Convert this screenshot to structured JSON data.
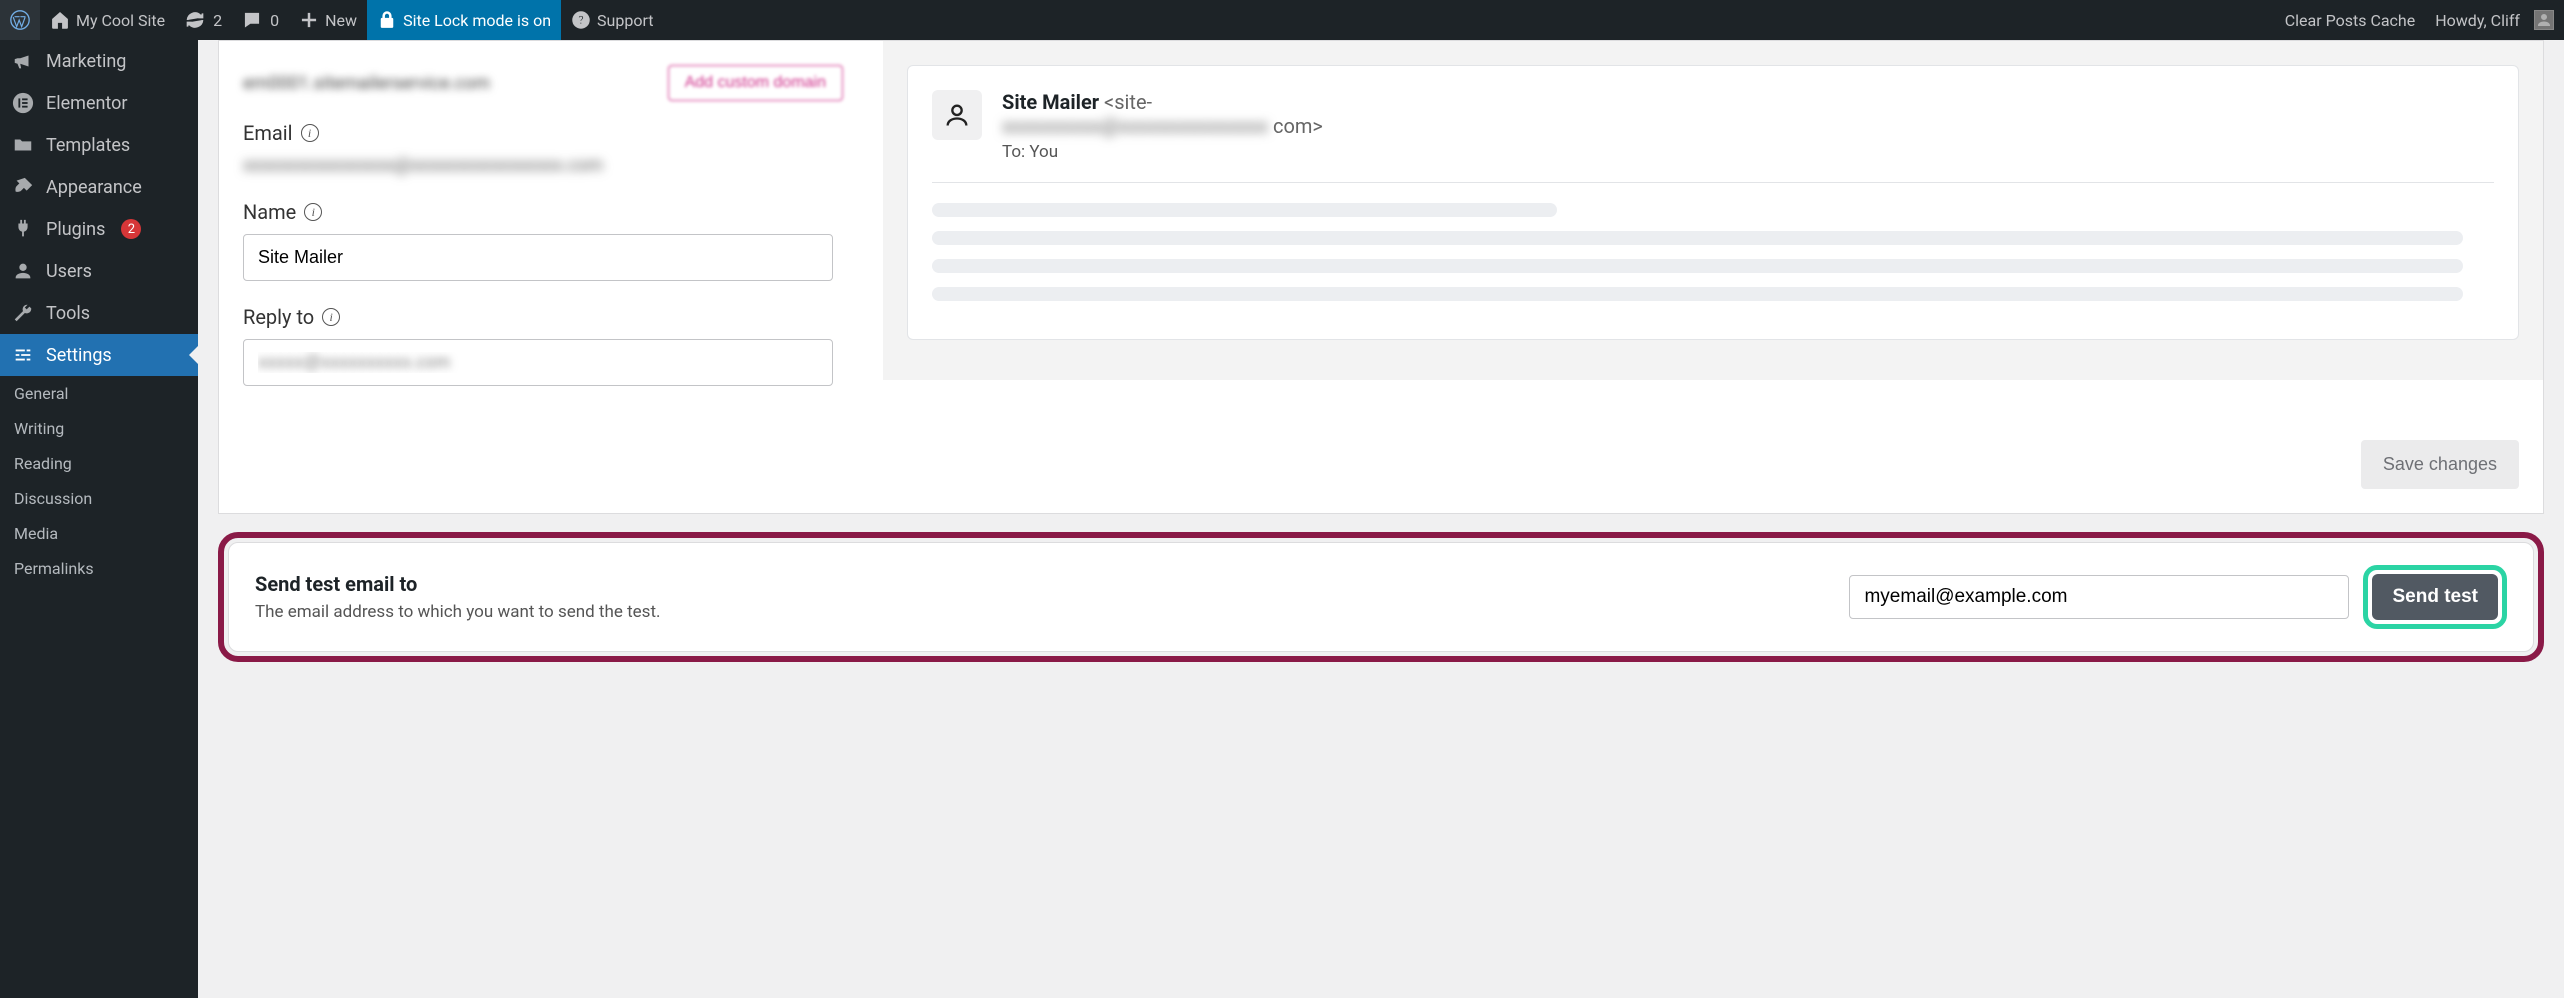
{
  "adminbar": {
    "site_name": "My Cool Site",
    "updates_count": "2",
    "comments_count": "0",
    "new_label": "New",
    "lock_label": "Site Lock mode is on",
    "support_label": "Support",
    "clear_cache": "Clear Posts Cache",
    "howdy": "Howdy, Cliff"
  },
  "sidebar": {
    "items": [
      {
        "label": "Marketing"
      },
      {
        "label": "Elementor"
      },
      {
        "label": "Templates"
      },
      {
        "label": "Appearance"
      },
      {
        "label": "Plugins",
        "badge": "2"
      },
      {
        "label": "Users"
      },
      {
        "label": "Tools"
      },
      {
        "label": "Settings",
        "active": true
      }
    ],
    "subitems": [
      {
        "label": "General"
      },
      {
        "label": "Writing"
      },
      {
        "label": "Reading"
      },
      {
        "label": "Discussion"
      },
      {
        "label": "Media"
      },
      {
        "label": "Permalinks"
      }
    ]
  },
  "main": {
    "domain_text": "em0001.sitemailerservice.com",
    "add_domain": "Add custom domain",
    "email_label": "Email",
    "email_value_redacted": "xxxxxxxxxxxxxxxxx@xxxxxxxxxxxxxxxxx.com",
    "name_label": "Name",
    "name_value": "Site Mailer",
    "reply_label": "Reply to",
    "reply_value_redacted": "xxxxx@xxxxxxxxxx.com",
    "save_label": "Save changes"
  },
  "preview": {
    "from_name": "Site Mailer",
    "from_addr_start": "<site-",
    "from_addr_mid": "xxxxxxxxxx@xxxxxxxxxxxxxxx",
    "from_addr_end": "com>",
    "to_line": "To: You"
  },
  "test": {
    "title": "Send test email to",
    "desc": "The email address to which you want to send the test.",
    "input_value": "myemail@example.com",
    "send_label": "Send test"
  }
}
